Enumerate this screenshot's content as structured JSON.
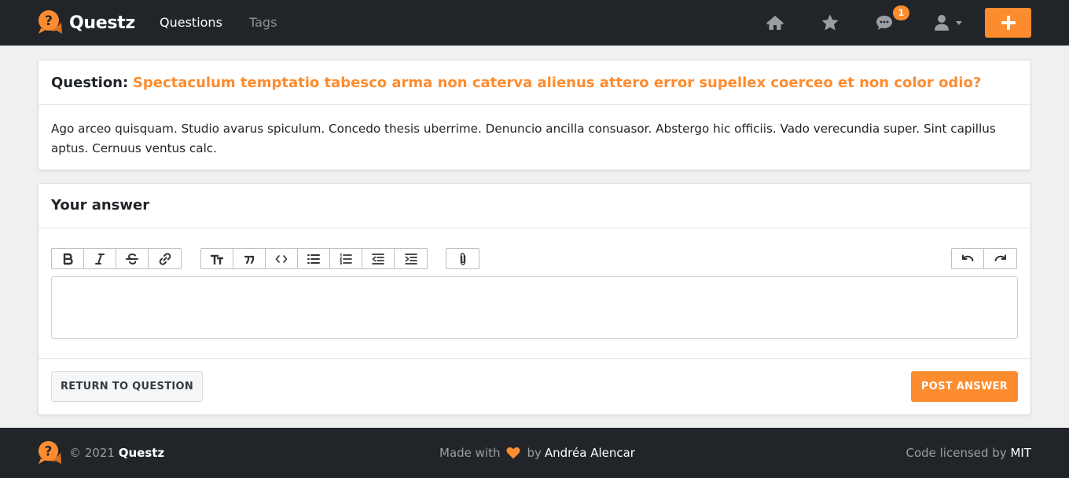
{
  "colors": {
    "accent": "#fd8c2f",
    "navbar_bg": "#212529",
    "page_bg": "#f0f0f0"
  },
  "navbar": {
    "brand": "Questz",
    "links": [
      {
        "label": "Questions",
        "active": true
      },
      {
        "label": "Tags",
        "active": false
      }
    ],
    "icons": [
      "home-icon",
      "star-icon",
      "chat-icon",
      "user-icon",
      "plus-icon"
    ],
    "notification_count": "1"
  },
  "question": {
    "label": "Question:",
    "title": "Spectaculum temptatio tabesco arma non caterva alienus attero error supellex coerceo et non color odio?",
    "body": "Ago arceo quisquam. Studio avarus spiculum. Concedo thesis uberrime. Denuncio ancilla consuasor. Abstergo hic officiis. Vado verecundia super. Sint capillus aptus. Cernuus ventus calc."
  },
  "answer": {
    "heading": "Your answer",
    "toolbar": [
      "bold",
      "italic",
      "strikethrough",
      "link",
      "heading",
      "quote",
      "code",
      "bullet-list",
      "numbered-list",
      "outdent",
      "indent",
      "attachment",
      "undo",
      "redo"
    ],
    "editor_value": "",
    "return_label": "RETURN TO QUESTION",
    "post_label": "POST ANSWER"
  },
  "footer": {
    "copyright": "© 2021",
    "brand": "Questz",
    "made_with": "Made with",
    "by": "by",
    "author": "Andréa Alencar",
    "license_text": "Code licensed by",
    "license": "MIT"
  }
}
